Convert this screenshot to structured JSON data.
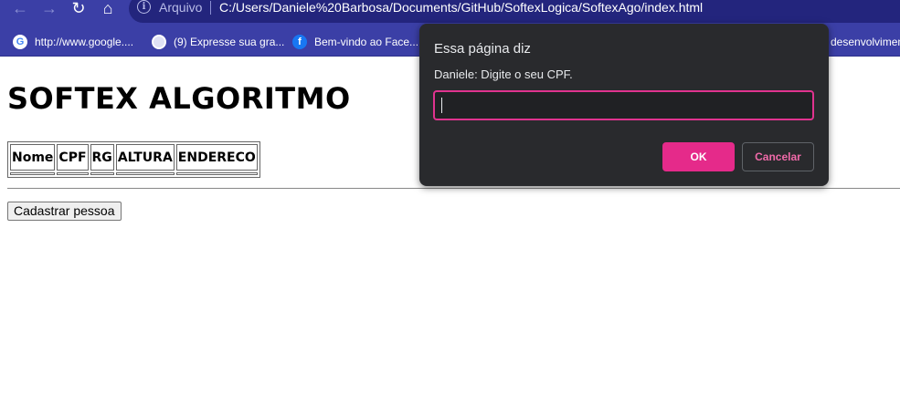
{
  "browser": {
    "url_scheme_label": "Arquivo",
    "url": "C:/Users/Daniele%20Barbosa/Documents/GitHub/SoftexLogica/SoftexAgo/index.html",
    "bookmarks": [
      {
        "label": "http://www.google....",
        "icon": "google-icon"
      },
      {
        "label": "(9) Expresse sua gra...",
        "icon": "globe-icon"
      },
      {
        "label": "Bem-vindo ao Face...",
        "icon": "facebook-icon"
      },
      {
        "label": "desenvolvimen",
        "icon": "none"
      }
    ]
  },
  "page": {
    "title": "SOFTEX ALGORITMO",
    "table_headers": [
      "Nome",
      "CPF",
      "RG",
      "ALTURA",
      "ENDERECO"
    ],
    "register_button": "Cadastrar pessoa"
  },
  "dialog": {
    "title": "Essa página diz",
    "message": "Daniele: Digite o seu CPF.",
    "input_value": "",
    "ok_label": "OK",
    "cancel_label": "Cancelar",
    "accent_color": "#e52a8a"
  }
}
